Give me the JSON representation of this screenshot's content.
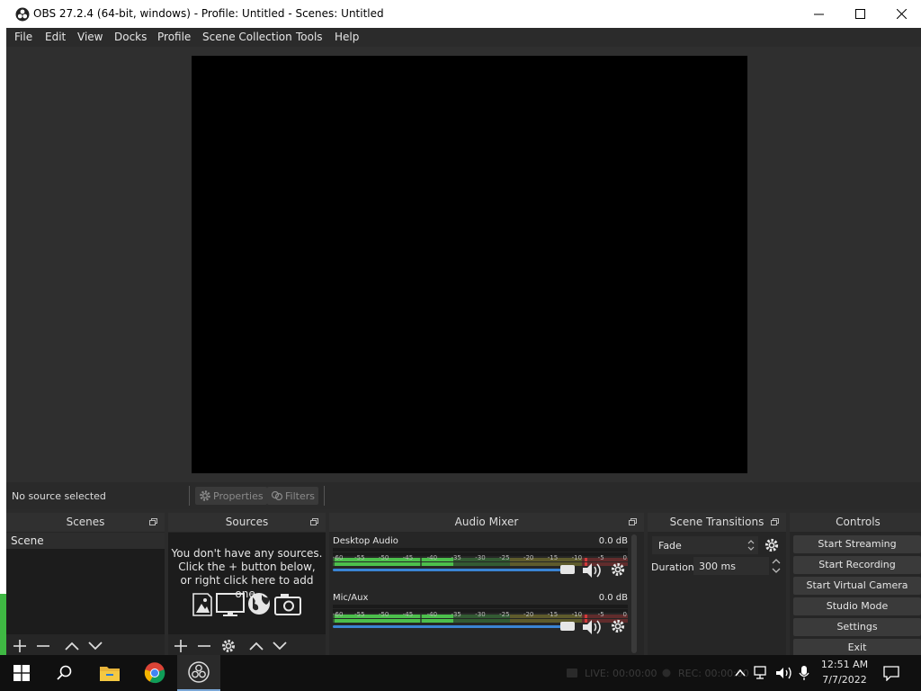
{
  "window": {
    "title": "OBS 27.2.4 (64-bit, windows) - Profile: Untitled - Scenes: Untitled"
  },
  "menu": [
    "File",
    "Edit",
    "View",
    "Docks",
    "Profile",
    "Scene Collection",
    "Tools",
    "Help"
  ],
  "source_toolbar": {
    "status": "No source selected",
    "properties_label": "Properties",
    "filters_label": "Filters"
  },
  "scenes": {
    "title": "Scenes",
    "items": [
      "Scene"
    ]
  },
  "sources": {
    "title": "Sources",
    "empty_line1": "You don't have any sources.",
    "empty_line2": "Click the + button below,",
    "empty_line3": "or right click here to add one."
  },
  "mixer": {
    "title": "Audio Mixer",
    "ticks": [
      "-60",
      "-55",
      "-50",
      "-45",
      "-40",
      "-35",
      "-30",
      "-25",
      "-20",
      "-15",
      "-10",
      "-5",
      "0"
    ],
    "channels": [
      {
        "name": "Desktop Audio",
        "db": "0.0 dB",
        "volume": 1.0
      },
      {
        "name": "Mic/Aux",
        "db": "0.0 dB",
        "volume": 1.0
      }
    ]
  },
  "transitions": {
    "title": "Scene Transitions",
    "selected": "Fade",
    "duration_label": "Duration",
    "duration_value": "300 ms"
  },
  "controls": {
    "title": "Controls",
    "buttons": [
      "Start Streaming",
      "Start Recording",
      "Start Virtual Camera",
      "Studio Mode",
      "Settings",
      "Exit"
    ]
  },
  "taskbar": {
    "live": "LIVE: 00:00:00",
    "rec": "REC: 00:00:00",
    "time": "12:51 AM",
    "date": "7/7/2022"
  },
  "colors": {
    "meter_green": "#4cbf4c",
    "meter_yellow": "#c8c03a",
    "meter_red": "#d03a3a",
    "slider_blue": "#3a84d4"
  }
}
